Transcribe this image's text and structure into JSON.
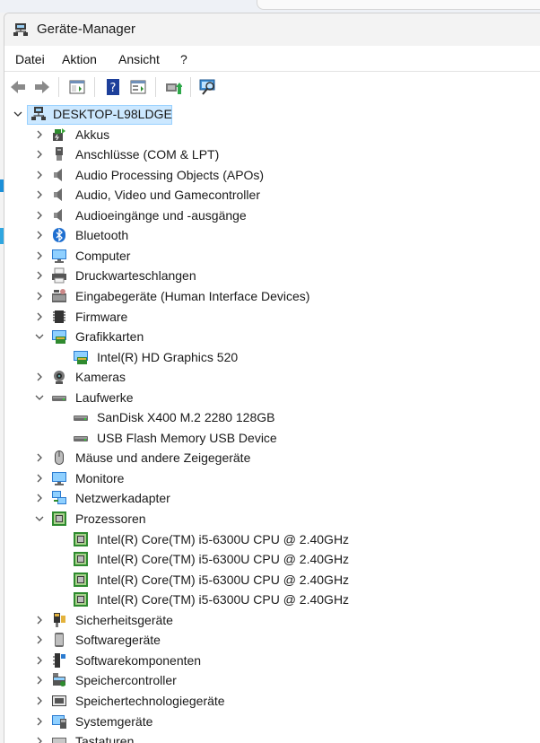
{
  "window": {
    "title": "Geräte-Manager"
  },
  "menu": {
    "items": [
      "Datei",
      "Aktion",
      "Ansicht",
      "?"
    ]
  },
  "toolbar": {
    "icons": [
      "back-arrow-icon",
      "forward-arrow-icon",
      "show-hide-console-tree-icon",
      "help-icon",
      "properties-icon",
      "update-driver-icon",
      "scan-hardware-icon"
    ]
  },
  "tree": {
    "root": "DESKTOP-L98LDGE",
    "items": [
      {
        "label": "Akkus",
        "expanded": false,
        "icon": "battery-icon"
      },
      {
        "label": "Anschlüsse (COM & LPT)",
        "expanded": false,
        "icon": "port-icon"
      },
      {
        "label": "Audio Processing Objects (APOs)",
        "expanded": false,
        "icon": "speaker-icon"
      },
      {
        "label": "Audio, Video und Gamecontroller",
        "expanded": false,
        "icon": "speaker-icon"
      },
      {
        "label": "Audioeingänge und -ausgänge",
        "expanded": false,
        "icon": "speaker-icon"
      },
      {
        "label": "Bluetooth",
        "expanded": false,
        "icon": "bluetooth-icon"
      },
      {
        "label": "Computer",
        "expanded": false,
        "icon": "monitor-icon"
      },
      {
        "label": "Druckwarteschlangen",
        "expanded": false,
        "icon": "printer-icon"
      },
      {
        "label": "Eingabegeräte (Human Interface Devices)",
        "expanded": false,
        "icon": "keyboard-person-icon"
      },
      {
        "label": "Firmware",
        "expanded": false,
        "icon": "chip-icon"
      },
      {
        "label": "Grafikkarten",
        "expanded": true,
        "icon": "display-adapter-icon",
        "children": [
          {
            "label": "Intel(R) HD Graphics 520",
            "icon": "display-adapter-icon"
          }
        ]
      },
      {
        "label": "Kameras",
        "expanded": false,
        "icon": "camera-icon"
      },
      {
        "label": "Laufwerke",
        "expanded": true,
        "icon": "drive-icon",
        "children": [
          {
            "label": "SanDisk X400 M.2 2280 128GB",
            "icon": "drive-icon"
          },
          {
            "label": "USB Flash Memory USB Device",
            "icon": "drive-icon"
          }
        ]
      },
      {
        "label": "Mäuse und andere Zeigegeräte",
        "expanded": false,
        "icon": "mouse-icon"
      },
      {
        "label": "Monitore",
        "expanded": false,
        "icon": "monitor-icon"
      },
      {
        "label": "Netzwerkadapter",
        "expanded": false,
        "icon": "network-icon"
      },
      {
        "label": "Prozessoren",
        "expanded": true,
        "icon": "processor-icon",
        "children": [
          {
            "label": "Intel(R) Core(TM) i5-6300U CPU @ 2.40GHz",
            "icon": "processor-icon"
          },
          {
            "label": "Intel(R) Core(TM) i5-6300U CPU @ 2.40GHz",
            "icon": "processor-icon"
          },
          {
            "label": "Intel(R) Core(TM) i5-6300U CPU @ 2.40GHz",
            "icon": "processor-icon"
          },
          {
            "label": "Intel(R) Core(TM) i5-6300U CPU @ 2.40GHz",
            "icon": "processor-icon"
          }
        ]
      },
      {
        "label": "Sicherheitsgeräte",
        "expanded": false,
        "icon": "security-key-icon"
      },
      {
        "label": "Softwaregeräte",
        "expanded": false,
        "icon": "software-device-icon"
      },
      {
        "label": "Softwarekomponenten",
        "expanded": false,
        "icon": "software-component-icon"
      },
      {
        "label": "Speichercontroller",
        "expanded": false,
        "icon": "storage-controller-icon"
      },
      {
        "label": "Speichertechnologiegeräte",
        "expanded": false,
        "icon": "memory-technology-icon"
      },
      {
        "label": "Systemgeräte",
        "expanded": false,
        "icon": "system-device-icon"
      },
      {
        "label": "Tastaturen",
        "expanded": false,
        "icon": "keyboard-icon"
      }
    ]
  },
  "colors": {
    "selection": "#cce8ff",
    "accent": "#1b8fd8"
  }
}
